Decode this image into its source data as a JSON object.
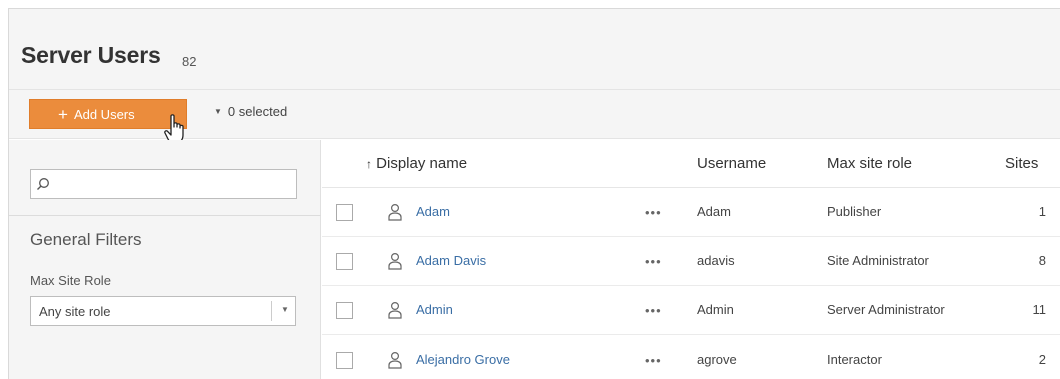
{
  "header": {
    "title": "Server Users",
    "count": "82"
  },
  "toolbar": {
    "add_users_label": "Add Users",
    "selected_label": "0 selected"
  },
  "sidebar": {
    "search": {
      "placeholder": "",
      "value": ""
    },
    "filters_title": "General Filters",
    "max_site_role": {
      "label": "Max Site Role",
      "selected": "Any site role"
    }
  },
  "table": {
    "columns": {
      "display_name": "Display name",
      "username": "Username",
      "max_site_role": "Max site role",
      "sites": "Sites"
    },
    "sort_indicator": "↑",
    "more_glyph": "•••",
    "rows": [
      {
        "display_name": "Adam",
        "username": "Adam",
        "role": "Publisher",
        "sites": "1"
      },
      {
        "display_name": "Adam Davis",
        "username": "adavis",
        "role": "Site Administrator",
        "sites": "8"
      },
      {
        "display_name": "Admin",
        "username": "Admin",
        "role": "Server Administrator",
        "sites": "11"
      },
      {
        "display_name": "Alejandro Grove",
        "username": "agrove",
        "role": "Interactor",
        "sites": "2"
      }
    ]
  },
  "colors": {
    "accent": "#eb8c3c",
    "link": "#3a6ea5",
    "panel_bg": "#f5f5f5"
  }
}
